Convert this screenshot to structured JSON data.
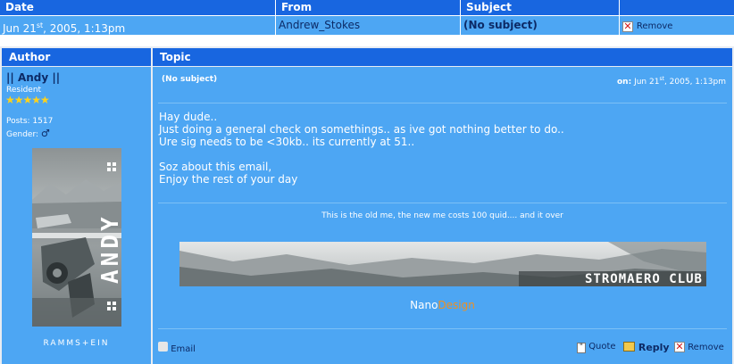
{
  "inbox": {
    "headers": {
      "date": "Date",
      "from": "From",
      "subject": "Subject"
    },
    "row": {
      "date": "Jun 21",
      "date_sup": "st",
      "date_rest": ", 2005, 1:13pm",
      "from": "Andrew_Stokes",
      "subject": "(No subject)",
      "remove": "Remove"
    }
  },
  "post": {
    "headers": {
      "author": "Author",
      "topic": "Topic"
    },
    "author": {
      "name": "|| Andy ||",
      "rank": "Resident",
      "stars": "★★★★★",
      "posts_line": "Posts: 1517",
      "gender_label": "Gender:",
      "gender_symbol": "♂",
      "avatar_text": "ANDY",
      "caption": "RAMMS+EIN"
    },
    "subject": "(No subject)",
    "date_prefix": "on:",
    "date": "Jun 21",
    "date_sup": "st",
    "date_rest": ", 2005, 1:13pm",
    "body": [
      "Hay dude..",
      "Just doing a general check on somethings.. as ive got nothing better to do..",
      "Ure sig needs to be <30kb.. its currently at 51..",
      "",
      "Soz about this email,",
      "Enjoy the rest of your day"
    ],
    "signature": {
      "line": "This is the old me, the new me costs 100 quid.... and it over",
      "banner_text": "STROMAERO CLUB",
      "credit_a": "Nano",
      "credit_b": "Design"
    },
    "actions": {
      "email": "Email",
      "quote": "Quote",
      "reply": "Reply",
      "remove": "Remove"
    }
  },
  "colors": {
    "header_bg": "#1866e0",
    "row_bg": "#4da6f3",
    "link_dark": "#0c2a66",
    "credit_orange": "#f09020"
  }
}
